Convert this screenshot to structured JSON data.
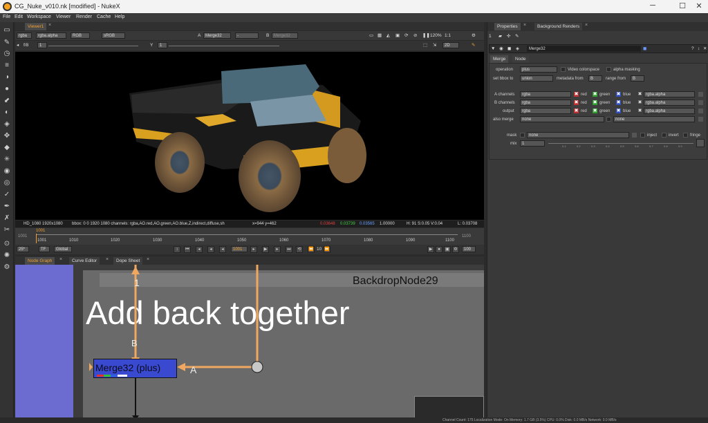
{
  "window": {
    "title": "CG_Nuke_v010.nk [modified] - NukeX",
    "minimize": "─",
    "maximize": "☐",
    "close": "✕"
  },
  "menu": [
    "File",
    "Edit",
    "Workspace",
    "Viewer",
    "Render",
    "Cache",
    "Help"
  ],
  "viewer": {
    "tab_label": "Viewer1",
    "channels": "rgba",
    "alpha": "rgba.alpha",
    "colorspace": "RGB",
    "display": "sRGB",
    "input_a_label": "A",
    "input_a": "Merge32",
    "composite": "-",
    "input_b_label": "B",
    "input_b": "Merge32",
    "zoom": "120%",
    "proxy": "1:1",
    "fstop": "f/8",
    "gain": "1",
    "gamma_label": "Y",
    "gamma": "1",
    "view_mode": "2D",
    "info": {
      "format": "HD_1080 1920x1080",
      "bbox": "bbox: 0 0 1920 1080 channels: rgba,AO.red,AO.green,AO.blue,Z,indirect,diffuse,sh",
      "coords": "x=944 y=462",
      "r": "0.03648",
      "g": "0.03739",
      "b": "0.03565",
      "a": "1.00000",
      "hsv": "H: 91 S:0.05 V:0.04",
      "l": "L: 0.03708"
    }
  },
  "timeline": {
    "current_frame": "1001",
    "in": "1001",
    "out": "1100",
    "ticks": [
      "1001",
      "1010",
      "1020",
      "1030",
      "1040",
      "1050",
      "1060",
      "1070",
      "1080",
      "1090",
      "1100"
    ],
    "fps": "25*",
    "tf": "TF",
    "global": "Global",
    "frame_field": "1001",
    "step": "10",
    "end": "100"
  },
  "panel_tabs": [
    "Node Graph",
    "Curve Editor",
    "Dope Sheet"
  ],
  "node_graph": {
    "backdrop_title": "BackdropNode29",
    "backdrop_text": "Add back together",
    "merge_node_label": "Merge32 (plus)",
    "input_a": "A",
    "input_b": "B",
    "pipe_label_top": "1",
    "colors": {
      "backdrop": "#6a6a6a",
      "merge": "#3a4ad0",
      "pipe": "#f0a860",
      "sidebar": "#6b6bd0"
    }
  },
  "properties": {
    "tabs": [
      "Properties",
      "Background Renders"
    ],
    "node_name": "Merge32",
    "sub_tabs": [
      "Merge",
      "Node"
    ],
    "operation_label": "operation",
    "operation": "plus",
    "video_colorspace": "Video colorspace",
    "alpha_masking": "alpha masking",
    "set_bbox_label": "set bbox to",
    "set_bbox": "union",
    "metadata_from_label": "metadata from",
    "metadata_from": "B",
    "range_from_label": "range from",
    "range_from": "B",
    "a_channels_label": "A channels",
    "b_channels_label": "B channels",
    "output_label": "output",
    "channel_value": "rgba",
    "alpha_value": "rgba.alpha",
    "red": "red",
    "green": "green",
    "blue": "blue",
    "also_merge_label": "also merge",
    "also_merge": "none",
    "also_merge2": "none",
    "mask_label": "mask",
    "mask": "none",
    "inject": "inject",
    "invert": "invert",
    "fringe": "fringe",
    "mix_label": "mix",
    "mix": "1",
    "mix_ticks": [
      "0.1",
      "0.2",
      "0.3",
      "0.4",
      "0.5",
      "0.6",
      "0.7",
      "0.8",
      "0.9"
    ]
  },
  "status": "Channel Count: 175  Localization Mode: On  Memory: 1.7 GB (3.5%)  CPU: 0.0%  Disk: 0.0 MB/s  Network: 0.0 MB/s"
}
